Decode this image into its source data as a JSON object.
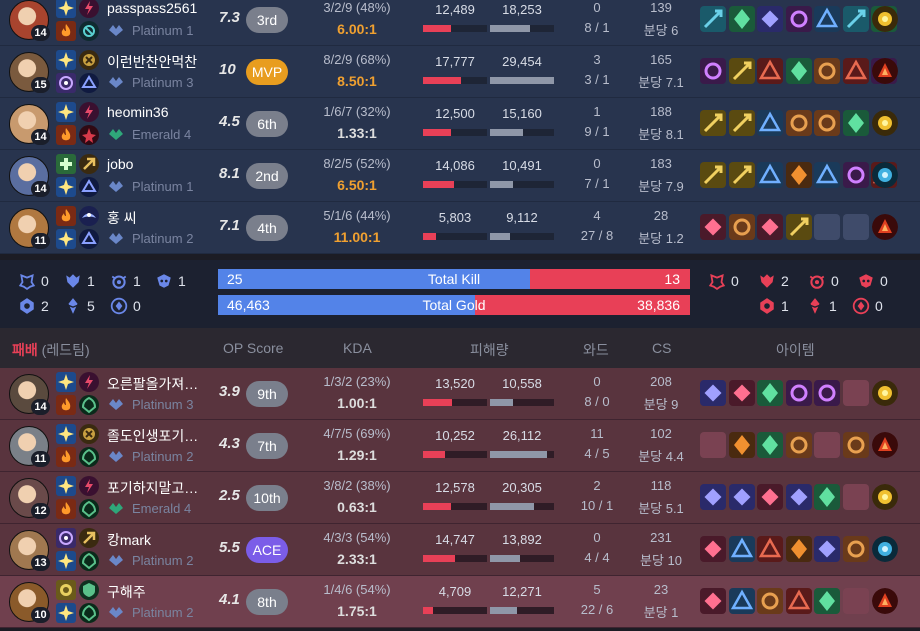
{
  "blue_players": [
    {
      "name": "passpass2561",
      "tier": "Platinum 1",
      "level": "14",
      "score": "7.3",
      "rank": "3rd",
      "badge": "plain",
      "kda": "3/2/9 (48%)",
      "ratio": "6.00:1",
      "ratio_color": "#f0a030",
      "dmg": "12,489",
      "taken": "18,253",
      "dmg_pct": 0.43,
      "taken_pct": 0.62,
      "ward": "0",
      "ward_detail": "8 / 1",
      "cs": "139",
      "cs_min": "분당 6",
      "champ_color": "#a8442e",
      "spell1": "flash",
      "spell2": "ignite",
      "rune1": "electrocute",
      "rune2": "inspiration",
      "tier_color": "#6a87c8"
    },
    {
      "name": "이런반찬안먹찬",
      "tier": "Platinum 3",
      "level": "15",
      "score": "10",
      "rank": "MVP",
      "badge": "mvp",
      "kda": "8/2/9 (68%)",
      "ratio": "8.50:1",
      "ratio_color": "#f0a030",
      "dmg": "17,777",
      "taken": "29,454",
      "dmg_pct": 0.6,
      "taken_pct": 1.0,
      "ward": "3",
      "ward_detail": "3 / 1",
      "cs": "165",
      "cs_min": "분당 7.1",
      "champ_color": "#7a5a3e",
      "spell1": "flash",
      "spell2": "teleport",
      "rune1": "conqueror",
      "rune2": "sorcery",
      "tier_color": "#6a87c8"
    },
    {
      "name": "heomin36",
      "tier": "Emerald 4",
      "level": "14",
      "score": "4.5",
      "rank": "6th",
      "badge": "plain",
      "kda": "1/6/7 (32%)",
      "ratio": "1.33:1",
      "ratio_color": "#dddddd",
      "dmg": "12,500",
      "taken": "15,160",
      "dmg_pct": 0.43,
      "taken_pct": 0.51,
      "ward": "1",
      "ward_detail": "9 / 1",
      "cs": "188",
      "cs_min": "분당 8.1",
      "champ_color": "#c89a6e",
      "spell1": "flash",
      "spell2": "ignite",
      "rune1": "electrocute",
      "rune2": "domination",
      "tier_color": "#2fa77a"
    },
    {
      "name": "jobo",
      "tier": "Platinum 1",
      "level": "14",
      "score": "8.1",
      "rank": "2nd",
      "badge": "plain",
      "kda": "8/2/5 (52%)",
      "ratio": "6.50:1",
      "ratio_color": "#f0a030",
      "dmg": "14,086",
      "taken": "10,491",
      "dmg_pct": 0.48,
      "taken_pct": 0.36,
      "ward": "0",
      "ward_detail": "7 / 1",
      "cs": "183",
      "cs_min": "분당 7.9",
      "champ_color": "#5a6ea0",
      "spell1": "heal",
      "spell2": "flash",
      "rune1": "lethal-tempo",
      "rune2": "sorcery",
      "tier_color": "#6a87c8"
    },
    {
      "name": "홍 씨",
      "tier": "Platinum 2",
      "level": "11",
      "score": "7.1",
      "rank": "4th",
      "badge": "plain",
      "kda": "5/1/6 (44%)",
      "ratio": "11.00:1",
      "ratio_color": "#f0a030",
      "dmg": "5,803",
      "taken": "9,112",
      "dmg_pct": 0.2,
      "taken_pct": 0.31,
      "ward": "4",
      "ward_detail": "27 / 8",
      "cs": "28",
      "cs_min": "분당 1.2",
      "champ_color": "#b07840",
      "spell1": "ignite",
      "spell2": "flash",
      "rune1": "aery",
      "rune2": "sorcery",
      "tier_color": "#6a87c8"
    }
  ],
  "red_players": [
    {
      "name": "오른팔올가져…",
      "tier": "Platinum 3",
      "level": "14",
      "score": "3.9",
      "rank": "9th",
      "badge": "plain",
      "kda": "1/3/2 (23%)",
      "ratio": "1.00:1",
      "ratio_color": "#dddddd",
      "dmg": "13,520",
      "taken": "10,558",
      "dmg_pct": 0.46,
      "taken_pct": 0.36,
      "ward": "0",
      "ward_detail": "8 / 0",
      "cs": "208",
      "cs_min": "분당 9",
      "champ_color": "#5a4a3e",
      "spell1": "flash",
      "spell2": "ignite",
      "rune1": "electrocute",
      "rune2": "resolve",
      "tier_color": "#6a87c8"
    },
    {
      "name": "졸도인생포기…",
      "tier": "Platinum 2",
      "level": "11",
      "score": "4.3",
      "rank": "7th",
      "badge": "plain",
      "kda": "4/7/5 (69%)",
      "ratio": "1.29:1",
      "ratio_color": "#dddddd",
      "dmg": "10,252",
      "taken": "26,112",
      "dmg_pct": 0.35,
      "taken_pct": 0.89,
      "ward": "11",
      "ward_detail": "4 / 5",
      "cs": "102",
      "cs_min": "분당 4.4",
      "champ_color": "#7a8088",
      "spell1": "flash",
      "spell2": "ignite",
      "rune1": "conqueror",
      "rune2": "resolve",
      "tier_color": "#6a87c8"
    },
    {
      "name": "포기하지말고…",
      "tier": "Emerald 4",
      "level": "12",
      "score": "2.5",
      "rank": "10th",
      "badge": "plain",
      "kda": "3/8/2 (38%)",
      "ratio": "0.63:1",
      "ratio_color": "#dddddd",
      "dmg": "12,578",
      "taken": "20,305",
      "dmg_pct": 0.43,
      "taken_pct": 0.69,
      "ward": "2",
      "ward_detail": "10 / 1",
      "cs": "118",
      "cs_min": "분당 5.1",
      "champ_color": "#6a4a4a",
      "spell1": "flash",
      "spell2": "ignite",
      "rune1": "electrocute",
      "rune2": "resolve",
      "tier_color": "#2fa77a"
    },
    {
      "name": "캉mark",
      "tier": "Platinum 2",
      "level": "13",
      "score": "5.5",
      "rank": "ACE",
      "badge": "ace",
      "kda": "4/3/3 (54%)",
      "ratio": "2.33:1",
      "ratio_color": "#dddddd",
      "dmg": "14,747",
      "taken": "13,892",
      "dmg_pct": 0.5,
      "taken_pct": 0.47,
      "ward": "0",
      "ward_detail": "4 / 4",
      "cs": "231",
      "cs_min": "분당 10",
      "champ_color": "#a07850",
      "spell1": "teleport",
      "spell2": "flash",
      "rune1": "lethal-tempo",
      "rune2": "resolve",
      "tier_color": "#6a87c8"
    },
    {
      "name": "구해주",
      "tier": "Platinum 2",
      "level": "10",
      "score": "4.1",
      "rank": "8th",
      "badge": "plain",
      "kda": "1/4/6 (54%)",
      "ratio": "1.75:1",
      "ratio_color": "#dddddd",
      "dmg": "4,709",
      "taken": "12,271",
      "dmg_pct": 0.16,
      "taken_pct": 0.42,
      "ward": "5",
      "ward_detail": "22 / 6",
      "cs": "23",
      "cs_min": "분당 1",
      "champ_color": "#8a5a2a",
      "spell1": "exhaust",
      "spell2": "flash",
      "rune1": "guardian",
      "rune2": "resolve",
      "tier_color": "#6a87c8"
    }
  ],
  "summary": {
    "blue_objectives": {
      "baron": "0",
      "dragon": "1",
      "herald": "1",
      "grub": "1",
      "tower": "2",
      "inhibitor": "5",
      "atakhan": "0"
    },
    "red_objectives": {
      "baron": "0",
      "dragon": "2",
      "herald": "0",
      "tower": "1",
      "inhibitor": "1",
      "atakhan": "0"
    },
    "total_kill_label": "Total Kill",
    "total_gold_label": "Total Gold",
    "blue_kill": "25",
    "red_kill": "13",
    "blue_kill_frac": 0.66,
    "blue_gold": "46,463",
    "red_gold": "38,836",
    "blue_gold_frac": 0.545
  },
  "header": {
    "result": "패배",
    "team": "(레드팀)",
    "score": "OP Score",
    "kda": "KDA",
    "damage": "피해량",
    "ward": "와드",
    "cs": "CS",
    "items": "아이템"
  },
  "colors": {
    "blue": "#5383e8",
    "red": "#e84057",
    "gold": "#f0a030"
  }
}
